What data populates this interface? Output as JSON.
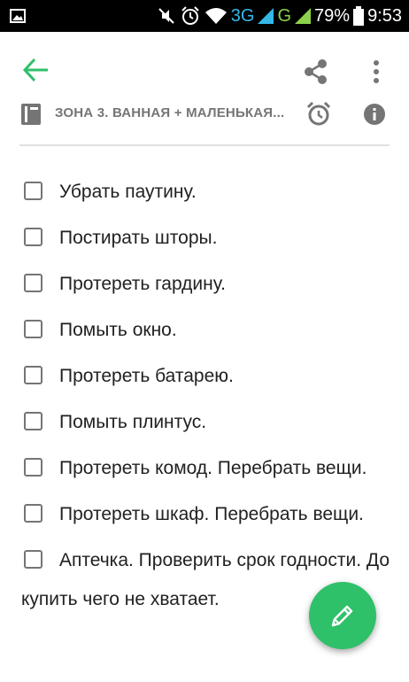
{
  "status_bar": {
    "network_3g": "3G",
    "network_g": "G",
    "battery": "79%",
    "time": "9:53"
  },
  "toolbar": {
    "back_icon": "arrow-left-icon",
    "share_icon": "share-icon",
    "more_icon": "more-vertical-icon"
  },
  "note": {
    "notebook_icon": "notebook-icon",
    "title": "ЗОНА 3. ВАННАЯ + МАЛЕНЬКАЯ...",
    "alarm_icon": "alarm-clock-icon",
    "info_icon": "info-icon"
  },
  "checklist": [
    {
      "text": "Убрать паутину.",
      "checked": false
    },
    {
      "text": "Постирать шторы.",
      "checked": false
    },
    {
      "text": "Протереть гардину.",
      "checked": false
    },
    {
      "text": "Помыть окно.",
      "checked": false
    },
    {
      "text": "Протереть батарею.",
      "checked": false
    },
    {
      "text": "Помыть плинтус.",
      "checked": false
    },
    {
      "text": "Протереть комод. Перебрать вещи.",
      "checked": false
    },
    {
      "text": "Протереть шкаф. Перебрать вещи.",
      "checked": false
    },
    {
      "text": "Аптечка. Проверить срок годности. До купить чего не хватает.",
      "checked": false
    }
  ],
  "fab": {
    "icon": "pencil-icon"
  },
  "colors": {
    "accent": "#2fc06a",
    "status_bar_bg": "#000000",
    "network_3g": "#35b7e8",
    "network_g": "#8bd14a"
  }
}
